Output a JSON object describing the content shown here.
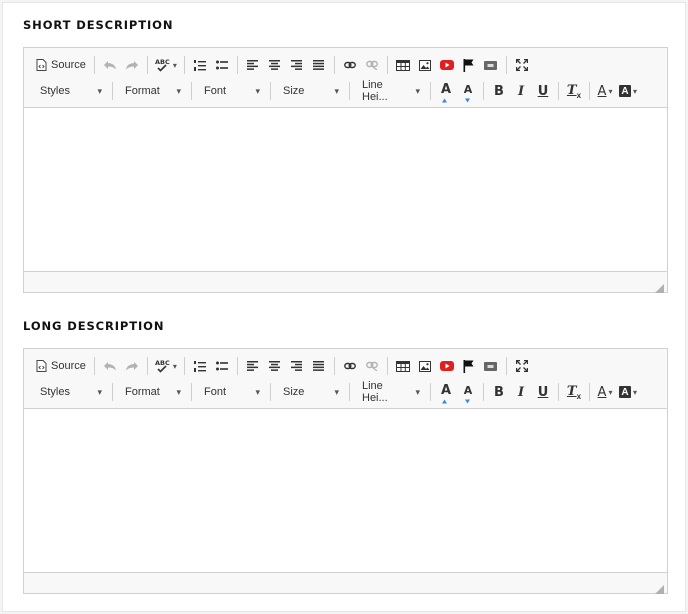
{
  "sections": [
    {
      "title": "SHORT DESCRIPTION",
      "toolbar": {
        "source_label": "Source",
        "styles_label": "Styles",
        "format_label": "Format",
        "font_label": "Font",
        "size_label": "Size",
        "line_height_label": "Line Hei..."
      }
    },
    {
      "title": "LONG DESCRIPTION",
      "toolbar": {
        "source_label": "Source",
        "styles_label": "Styles",
        "format_label": "Format",
        "font_label": "Font",
        "size_label": "Size",
        "line_height_label": "Line Hei..."
      }
    }
  ],
  "glyphs": {
    "bold": "B",
    "italic": "I",
    "underline": "U",
    "remove_format": "T",
    "remove_format_sub": "x",
    "text_color": "A",
    "bg_color": "A",
    "font_up": "A",
    "font_down": "A",
    "spell": "ABC",
    "dropdown_caret": "▾"
  },
  "colors": {
    "youtube_red": "#e02020",
    "toolbar_bg": "#f8f8f8",
    "border": "#d1d1d1",
    "icon": "#333333",
    "font_size_arrow": "#3a8ad8"
  },
  "icons": [
    "source-icon",
    "undo-icon",
    "redo-icon",
    "spellcheck-icon",
    "numbered-list-icon",
    "bulleted-list-icon",
    "align-left-icon",
    "align-center-icon",
    "align-right-icon",
    "justify-icon",
    "link-icon",
    "unlink-icon",
    "table-icon",
    "image-icon",
    "youtube-icon",
    "flag-icon",
    "embed-icon",
    "maximize-icon",
    "increase-font-icon",
    "decrease-font-icon",
    "bold-icon",
    "italic-icon",
    "underline-icon",
    "remove-format-icon",
    "text-color-icon",
    "background-color-icon",
    "resize-grip-icon"
  ]
}
